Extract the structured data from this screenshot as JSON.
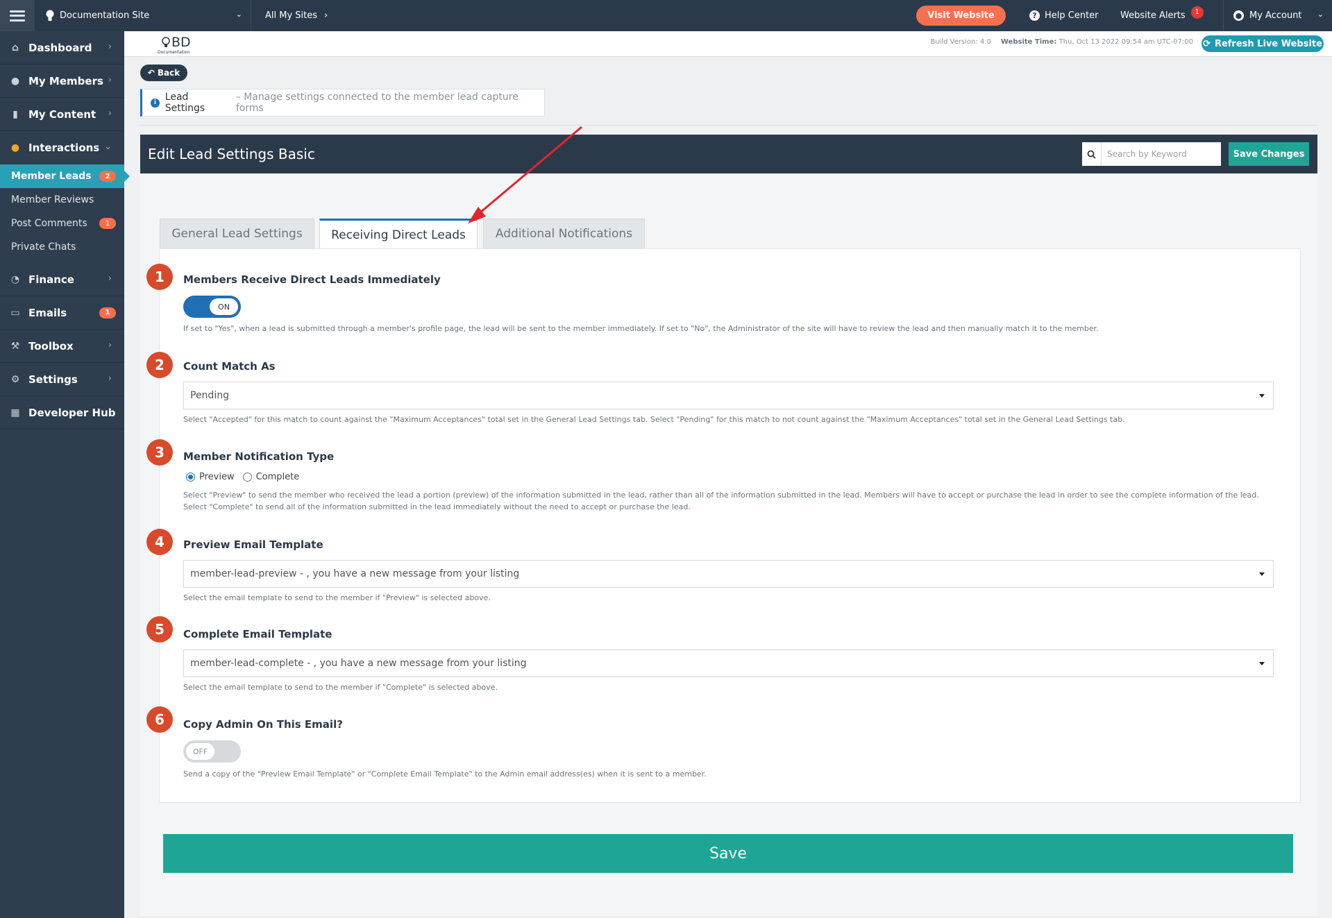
{
  "topbar": {
    "site_name": "Documentation Site",
    "all_sites": "All My Sites",
    "visit_website": "Visit Website",
    "help_center": "Help Center",
    "website_alerts": "Website Alerts",
    "alerts_count": "1",
    "my_account": "My Account"
  },
  "sidebar": {
    "items": [
      {
        "label": "Dashboard",
        "icon": "dashboard-icon"
      },
      {
        "label": "My Members",
        "icon": "members-icon"
      },
      {
        "label": "My Content",
        "icon": "folder-icon"
      },
      {
        "label": "Interactions",
        "icon": "chat-icon"
      }
    ],
    "sub_items": [
      {
        "label": "Member Leads",
        "badge": "2"
      },
      {
        "label": "Member Reviews"
      },
      {
        "label": "Post Comments",
        "badge": "1"
      },
      {
        "label": "Private Chats"
      }
    ],
    "items_after": [
      {
        "label": "Finance",
        "icon": "pie-chart-icon"
      },
      {
        "label": "Emails",
        "icon": "inbox-icon",
        "badge": "1"
      },
      {
        "label": "Toolbox",
        "icon": "wrench-icon"
      },
      {
        "label": "Settings",
        "icon": "gear-icon"
      },
      {
        "label": "Developer Hub",
        "icon": "grid-icon"
      }
    ]
  },
  "subheader": {
    "logo_text": "BD",
    "logo_sub": "Documentation",
    "build_label": "Build Version: 4.0",
    "time_label": "Website Time:",
    "time_value": "Thu, Oct 13 2022 09:54 am UTC-07:00",
    "refresh_label": "Refresh Live Website"
  },
  "back_label": "Back",
  "info": {
    "title": "Lead Settings",
    "desc": "– Manage settings connected to the member lead capture forms"
  },
  "panel": {
    "title": "Edit Lead Settings Basic",
    "search_placeholder": "Search by Keyword",
    "save_changes": "Save Changes"
  },
  "tabs": [
    {
      "label": "General Lead Settings",
      "active": false
    },
    {
      "label": "Receiving Direct Leads",
      "active": true
    },
    {
      "label": "Additional Notifications",
      "active": false
    }
  ],
  "fields": {
    "f1": {
      "num": "1",
      "label": "Members Receive Direct Leads Immediately",
      "toggle": "ON",
      "help": "If set to \"Yes\", when a lead is submitted through a member's profile page, the lead will be sent to the member immediately. If set to \"No\", the Administrator of the site will have to review the lead and then manually match it to the member."
    },
    "f2": {
      "num": "2",
      "label": "Count Match As",
      "value": "Pending",
      "help": "Select \"Accepted\" for this match to count against the \"Maximum Acceptances\" total set in the General Lead Settings tab. Select \"Pending\" for this match to not count against the \"Maximum Acceptances\" total set in the General Lead Settings tab."
    },
    "f3": {
      "num": "3",
      "label": "Member Notification Type",
      "option_preview": "Preview",
      "option_complete": "Complete",
      "selected": "Preview",
      "help1": "Select \"Preview\" to send the member who received the lead a portion (preview) of the information submitted in the lead, rather than all of the information submitted in the lead. Members will have to accept or purchase the lead in order to see the complete information of the lead.",
      "help2": "Select \"Complete\" to send all of the information submitted in the lead immediately without the need to accept or purchase the lead."
    },
    "f4": {
      "num": "4",
      "label": "Preview Email Template",
      "value": "member-lead-preview - , you have a new message from your listing",
      "help": "Select the email template to send to the member if \"Preview\" is selected above."
    },
    "f5": {
      "num": "5",
      "label": "Complete Email Template",
      "value": "member-lead-complete - , you have a new message from your listing",
      "help": "Select the email template to send to the member if \"Complete\" is selected above."
    },
    "f6": {
      "num": "6",
      "label": "Copy Admin On This Email?",
      "toggle": "OFF",
      "help": "Send a copy of the \"Preview Email Template\" or \"Complete Email Template\" to the Admin email address(es) when it is sent to a member."
    }
  },
  "save_label": "Save",
  "colors": {
    "accent": "#1f6fb5",
    "teal": "#1fa595",
    "step": "#d84a2b",
    "topbar": "#2b3a4a",
    "annotation_arrow": "#e0252b"
  }
}
